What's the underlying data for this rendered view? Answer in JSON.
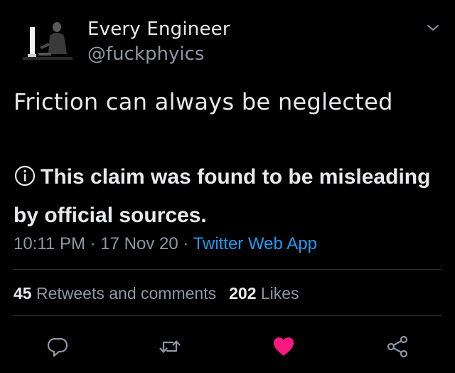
{
  "tweet": {
    "display_name": "Every Engineer",
    "handle": "@fuckphyics",
    "text": "Friction can always be neglected",
    "claim_notice": "This claim was found to be misleading by official sources.",
    "time": "10:11 PM",
    "date": "17 Nov 20",
    "separator": "·",
    "source": "Twitter Web App",
    "retweets_count": "45",
    "retweets_label": "Retweets and comments",
    "likes_count": "202",
    "likes_label": "Likes",
    "liked": true
  },
  "colors": {
    "background": "#000000",
    "primary_text": "#e7e9ea",
    "secondary_text": "#8b98a5",
    "link": "#1d9bf0",
    "like": "#f91880",
    "divider": "#2f3336"
  },
  "icons": {
    "avatar": "person-at-computer-avatar",
    "menu": "chevron-down-icon",
    "notice": "info-circle-icon",
    "reply": "reply-icon",
    "retweet": "retweet-icon",
    "like": "heart-icon",
    "share": "share-icon"
  }
}
